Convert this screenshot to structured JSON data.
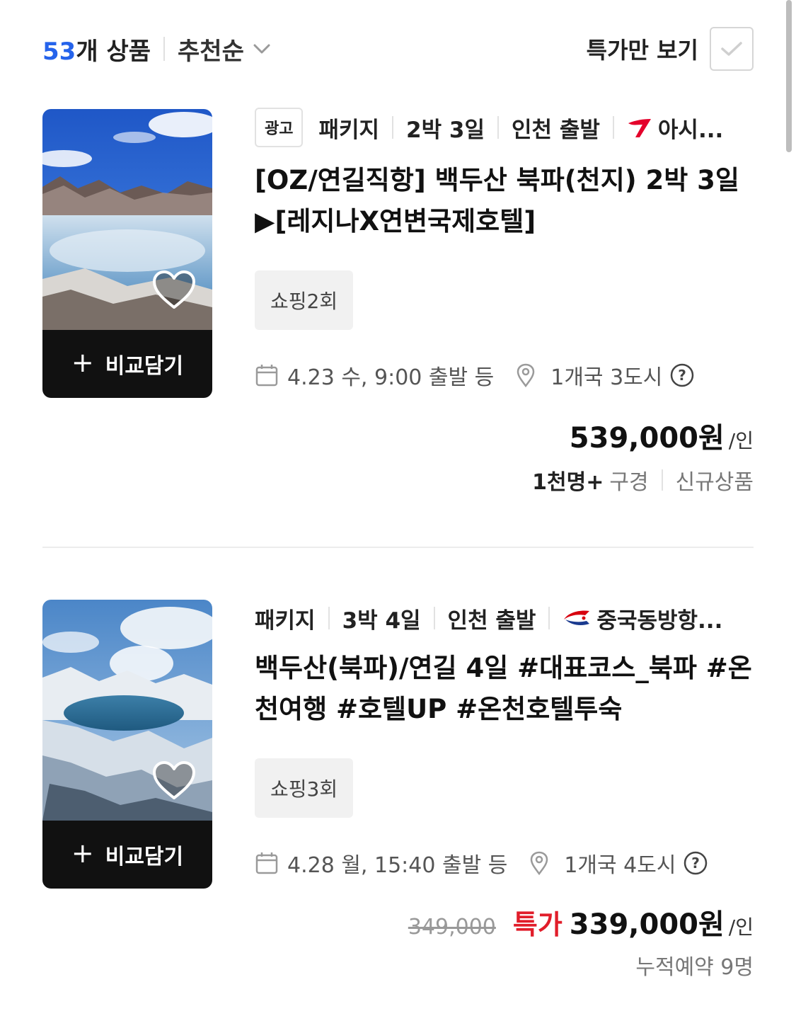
{
  "header": {
    "count_num": "53",
    "count_label": "개 상품",
    "sort_label": "추천순",
    "filter_label": "특가만 보기"
  },
  "products": [
    {
      "ad_label": "광고",
      "type": "패키지",
      "duration": "2박 3일",
      "departure": "인천 출발",
      "airline": "아시...",
      "title": "[OZ/연길직항] 백두산 북파(천지) 2박 3일 ▶[레지나X연변국제호텔]",
      "tag": "쇼핑2회",
      "date": "4.23 수, 9:00 출발 등",
      "location": "1개국 3도시",
      "compare_label": "비교담기",
      "price": "539,000원",
      "per_person": "/인",
      "travelers": "1천명+",
      "travelers_suffix": "구경",
      "badge": "신규상품"
    },
    {
      "type": "패키지",
      "duration": "3박 4일",
      "departure": "인천 출발",
      "airline": "중국동방항...",
      "title": "백두산(북파)/연길 4일 #대표코스_북파 #온천여행 #호텔UP #온천호텔투숙",
      "tag": "쇼핑3회",
      "date": "4.28 월, 15:40 출발 등",
      "location": "1개국 4도시",
      "compare_label": "비교담기",
      "original_price": "349,000",
      "special_label": "특가",
      "price": "339,000원",
      "per_person": "/인",
      "bookings": "누적예약 9명"
    }
  ],
  "colors": {
    "accent_blue": "#2563eb",
    "special_red": "#e11d2a",
    "asiana_red": "#e4002b",
    "china_eastern_red": "#d7000f",
    "china_eastern_blue": "#1a3a8f"
  }
}
